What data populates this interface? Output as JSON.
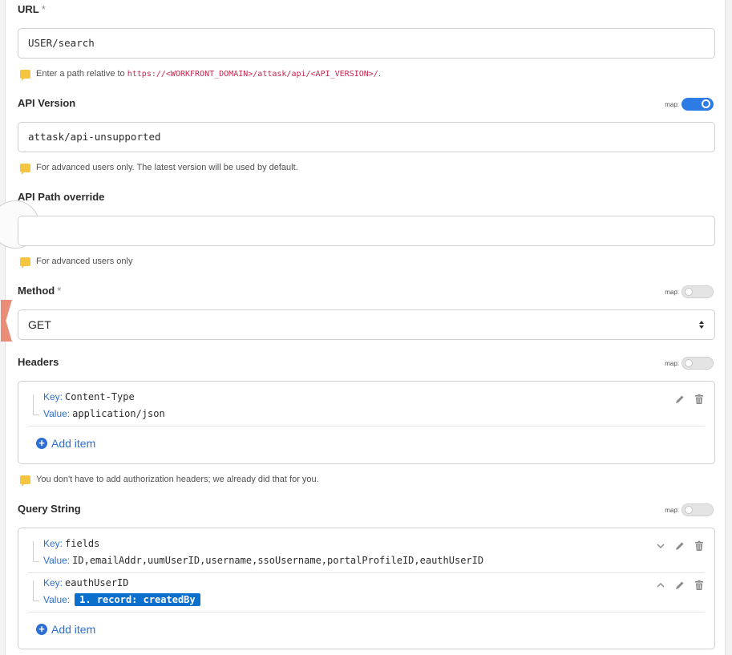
{
  "url": {
    "label": "URL",
    "required": "*",
    "value": "USER/search",
    "hint_prefix": "Enter a path relative to ",
    "hint_code": "https://<WORKFRONT_DOMAIN>/attask/api/<API_VERSION>/",
    "hint_suffix": "."
  },
  "api_version": {
    "label": "API Version",
    "map_label": "map:",
    "map_on": true,
    "value": "attask/api-unsupported",
    "hint": "For advanced users only. The latest version will be used by default."
  },
  "api_path_override": {
    "label": "API Path override",
    "value": "",
    "hint": "For advanced users only"
  },
  "method": {
    "label": "Method",
    "required": "*",
    "map_label": "map:",
    "map_on": false,
    "value": "GET"
  },
  "headers": {
    "label": "Headers",
    "map_label": "map:",
    "map_on": false,
    "items": [
      {
        "key_label": "Key:",
        "key": "Content-Type",
        "value_label": "Value:",
        "value": "application/json"
      }
    ],
    "add_item": "Add item",
    "hint": "You don't have to add authorization headers; we already did that for you."
  },
  "query_string": {
    "label": "Query String",
    "map_label": "map:",
    "map_on": false,
    "items": [
      {
        "key_label": "Key:",
        "key": "fields",
        "value_label": "Value:",
        "value": "ID,emailAddr,uumUserID,username,ssoUsername,portalProfileID,eauthUserID"
      },
      {
        "key_label": "Key:",
        "key": "eauthUserID",
        "value_label": "Value:",
        "value": "1. record: createdBy"
      }
    ],
    "add_item": "Add item"
  },
  "colors": {
    "accent": "#2d7be5",
    "link": "#2d6fd2",
    "pill": "#0b6fce",
    "note": "#f5c542",
    "code": "#c7254e"
  }
}
